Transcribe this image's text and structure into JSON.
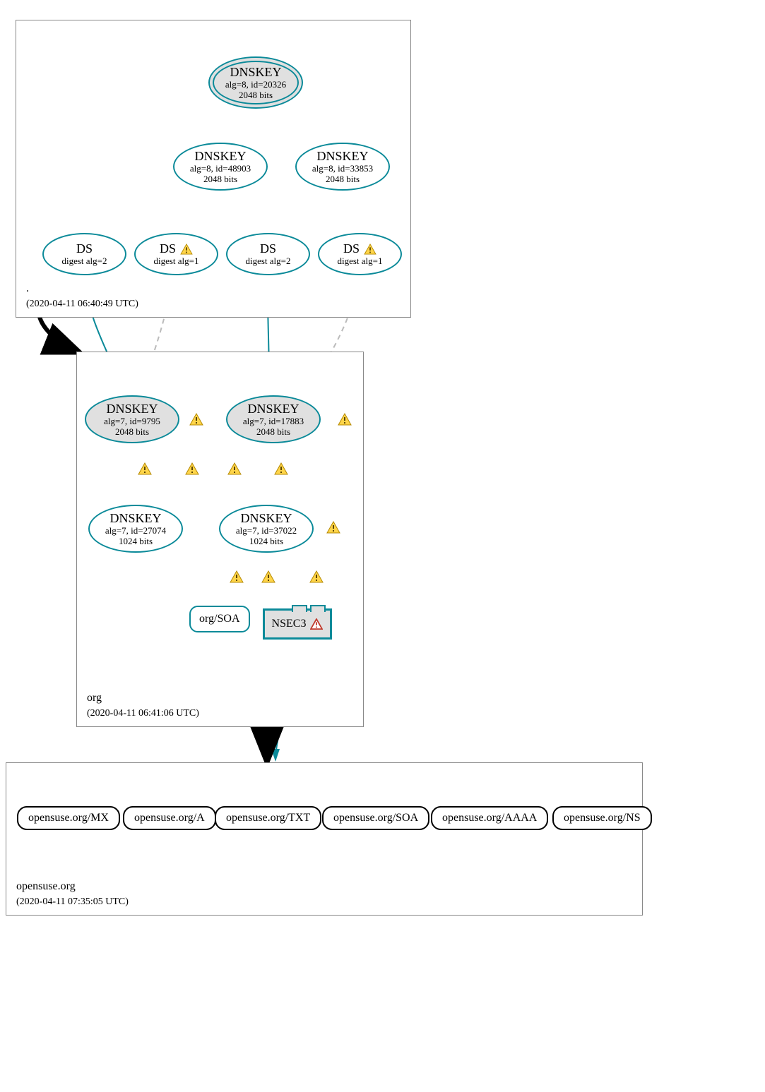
{
  "zones": {
    "root": {
      "name": ".",
      "timestamp": "(2020-04-11 06:40:49 UTC)"
    },
    "org": {
      "name": "org",
      "timestamp": "(2020-04-11 06:41:06 UTC)"
    },
    "leaf": {
      "name": "opensuse.org",
      "timestamp": "(2020-04-11 07:35:05 UTC)"
    }
  },
  "dnskeys": {
    "a": {
      "title": "DNSKEY",
      "line2": "alg=8, id=20326",
      "line3": "2048 bits"
    },
    "b": {
      "title": "DNSKEY",
      "line2": "alg=8, id=48903",
      "line3": "2048 bits"
    },
    "c": {
      "title": "DNSKEY",
      "line2": "alg=8, id=33853",
      "line3": "2048 bits"
    },
    "d": {
      "title": "DNSKEY",
      "line2": "alg=7, id=9795",
      "line3": "2048 bits"
    },
    "e": {
      "title": "DNSKEY",
      "line2": "alg=7, id=17883",
      "line3": "2048 bits"
    },
    "f": {
      "title": "DNSKEY",
      "line2": "alg=7, id=27074",
      "line3": "1024 bits"
    },
    "g": {
      "title": "DNSKEY",
      "line2": "alg=7, id=37022",
      "line3": "1024 bits"
    }
  },
  "ds": {
    "a": {
      "title": "DS",
      "line2": "digest alg=2"
    },
    "b": {
      "title": "DS",
      "line2": "digest alg=1"
    },
    "c": {
      "title": "DS",
      "line2": "digest alg=2"
    },
    "d": {
      "title": "DS",
      "line2": "digest alg=1"
    }
  },
  "records": {
    "soa": "org/SOA",
    "nsec3": "NSEC3"
  },
  "rrsets": {
    "mx": "opensuse.org/MX",
    "a": "opensuse.org/A",
    "txt": "opensuse.org/TXT",
    "soa": "opensuse.org/SOA",
    "aaaa": "opensuse.org/AAAA",
    "ns": "opensuse.org/NS"
  }
}
